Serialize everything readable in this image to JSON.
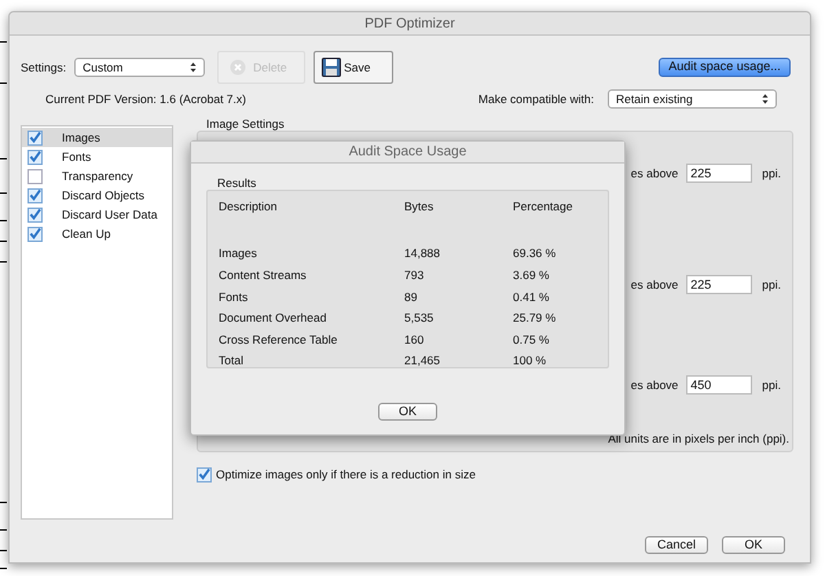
{
  "window": {
    "title": "PDF Optimizer"
  },
  "settings": {
    "label": "Settings:",
    "value": "Custom"
  },
  "buttons": {
    "delete": {
      "label": "Delete",
      "disabled": true
    },
    "save": {
      "label": "Save"
    },
    "audit": {
      "label": "Audit space usage..."
    }
  },
  "version": "Current PDF Version: 1.6 (Acrobat 7.x)",
  "compatible": {
    "label": "Make compatible with:",
    "value": "Retain existing"
  },
  "sidebar": {
    "items": [
      {
        "label": "Images",
        "checked": true,
        "selected": true
      },
      {
        "label": "Fonts",
        "checked": true,
        "selected": false
      },
      {
        "label": "Transparency",
        "checked": false,
        "selected": false
      },
      {
        "label": "Discard Objects",
        "checked": true,
        "selected": false
      },
      {
        "label": "Discard User Data",
        "checked": true,
        "selected": false
      },
      {
        "label": "Clean Up",
        "checked": true,
        "selected": false
      }
    ]
  },
  "image_settings": {
    "title": "Image Settings",
    "rows": [
      {
        "label": "es above",
        "value": "225",
        "unit": "ppi."
      },
      {
        "label": "es above",
        "value": "225",
        "unit": "ppi."
      },
      {
        "label": "es above",
        "value": "450",
        "unit": "ppi."
      }
    ],
    "note": "All units are in pixels per inch (ppi)."
  },
  "optimize_checkbox": {
    "label": "Optimize images only if there is a reduction in size",
    "checked": true
  },
  "footer_buttons": [
    "Cancel",
    "OK"
  ],
  "dialog": {
    "title": "Audit Space Usage",
    "group": "Results",
    "columns": [
      "Description",
      "Bytes",
      "Percentage"
    ],
    "rows": [
      [
        "Images",
        "14,888",
        "69.36 %"
      ],
      [
        "Content Streams",
        "793",
        "3.69 %"
      ],
      [
        "Fonts",
        "89",
        "0.41 %"
      ],
      [
        "Document Overhead",
        "5,535",
        "25.79 %"
      ],
      [
        "Cross Reference Table",
        "160",
        "0.75 %"
      ],
      [
        "Total",
        "21,465",
        "100 %"
      ]
    ],
    "button": "OK"
  }
}
